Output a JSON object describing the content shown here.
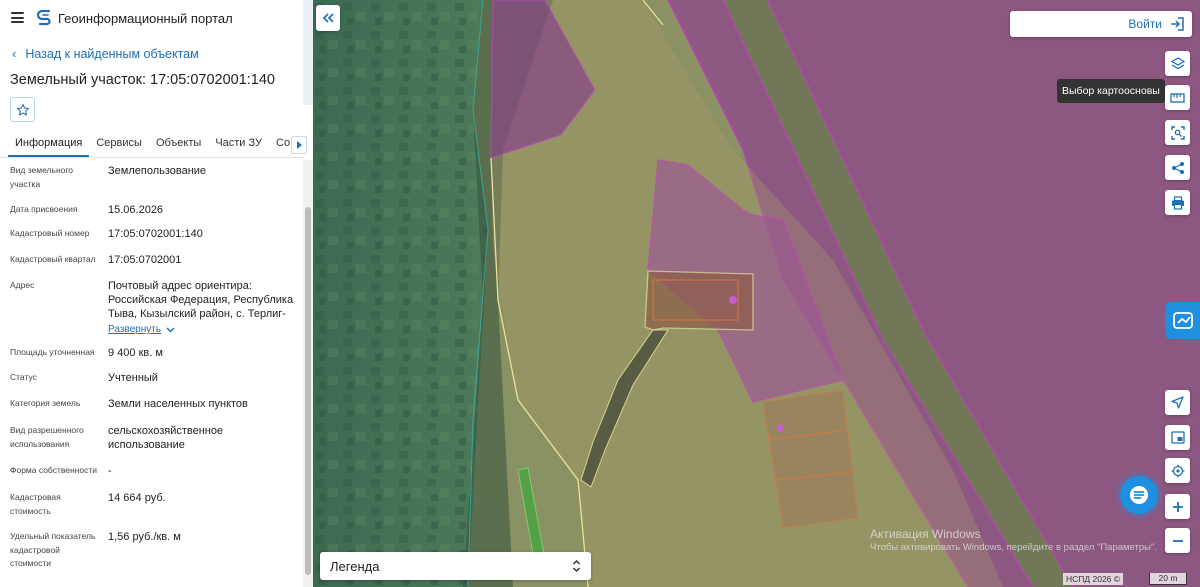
{
  "app": {
    "title": "Геоинформационный портал"
  },
  "panel": {
    "back_label": "Назад к найденным объектам",
    "parcel_title": "Земельный участок: 17:05:0702001:140",
    "tabs": [
      {
        "label": "Информация",
        "active": true
      },
      {
        "label": "Сервисы"
      },
      {
        "label": "Объекты"
      },
      {
        "label": "Части ЗУ"
      },
      {
        "label": "Состав"
      }
    ],
    "fields": [
      {
        "label": "Вид земельного участка",
        "value": "Землепользование"
      },
      {
        "label": "Дата присвоения",
        "value": "15.06.2026"
      },
      {
        "label": "Кадастровый номер",
        "value": "17:05:0702001:140"
      },
      {
        "label": "Кадастровый квартал",
        "value": "17:05:0702001"
      },
      {
        "label": "Адрес",
        "value": "Почтовый адрес ориентира: Российская Федерация, Республика Тыва, Кызылский район, с. Терлиг-",
        "expand_label": "Развернуть"
      },
      {
        "label": "Площадь уточненная",
        "value": "9 400 кв. м"
      },
      {
        "label": "Статус",
        "value": "Учтенный"
      },
      {
        "label": "Категория земель",
        "value": "Земли населенных пунктов"
      },
      {
        "label": "Вид разрешенного использования",
        "value": "сельскохозяйственное использование"
      },
      {
        "label": "Форма собственности",
        "value": "-"
      },
      {
        "label": "Кадастровая стоимость",
        "value": "14 664 руб."
      },
      {
        "label": "Удельный показатель кадастровой стоимости",
        "value": "1,56 руб./кв. м"
      }
    ]
  },
  "map": {
    "login_label": "Войти",
    "tooltip": "Выбор картоосновы",
    "legend_label": "Легенда",
    "watermark_title": "Активация Windows",
    "watermark_text": "Чтобы активировать Windows, перейдите в раздел \"Параметры\".",
    "copyright": "НСПД 2026 ©",
    "scale_label": "20 m",
    "colors": {
      "accent": "#1e6fb4",
      "parcel_outline": "#c23fbf",
      "parcel_fill": "#a24a9f",
      "boundary_yellow": "#e9e29a",
      "zone_orange": "#e0733a"
    }
  }
}
